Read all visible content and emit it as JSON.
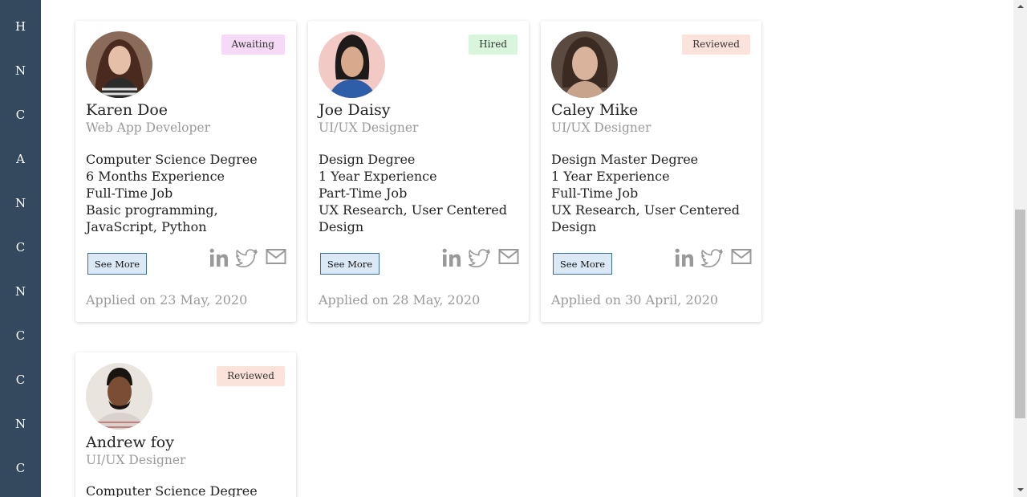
{
  "sidebar": {
    "items": [
      {
        "label": "H"
      },
      {
        "label": "N"
      },
      {
        "label": "C"
      },
      {
        "label": "A"
      },
      {
        "label": "N"
      },
      {
        "label": "C"
      },
      {
        "label": "N"
      },
      {
        "label": "C"
      },
      {
        "label": "C"
      },
      {
        "label": "N"
      },
      {
        "label": "C"
      }
    ]
  },
  "colors": {
    "sidebar_bg": "#34495e",
    "badge_awaiting": "#f6d9f6",
    "badge_hired": "#d9f5dc",
    "badge_reviewed": "#fbe3dc",
    "button_bg": "#dbe9f7"
  },
  "candidates": [
    {
      "name": "Karen Doe",
      "role": "Web App Developer",
      "status": "Awaiting",
      "details": [
        "Computer Science Degree",
        "6 Months Experience",
        "Full-Time Job",
        "Basic programming, JavaScript, Python"
      ],
      "button_label": "See More",
      "applied": "Applied on 23 May, 2020"
    },
    {
      "name": "Joe Daisy",
      "role": "UI/UX Designer",
      "status": "Hired",
      "details": [
        "Design Degree",
        "1 Year Experience",
        "Part-Time Job",
        "UX Research, User Centered Design"
      ],
      "button_label": "See More",
      "applied": "Applied on 28 May, 2020"
    },
    {
      "name": "Caley Mike",
      "role": "UI/UX Designer",
      "status": "Reviewed",
      "details": [
        "Design Master Degree",
        "1 Year Experience",
        "Full-Time Job",
        "UX Research, User Centered Design"
      ],
      "button_label": "See More",
      "applied": "Applied on 30 April, 2020"
    },
    {
      "name": "Andrew foy",
      "role": "UI/UX Designer",
      "status": "Reviewed",
      "details": [
        "Computer Science Degree"
      ]
    }
  ],
  "icons": {
    "search": "search-icon",
    "social": [
      "linkedin-icon",
      "twitter-icon",
      "mail-icon"
    ]
  }
}
